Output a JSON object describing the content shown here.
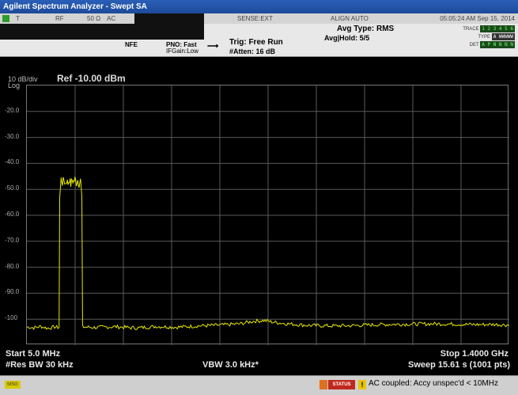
{
  "window": {
    "title": "Agilent Spectrum Analyzer - Swept SA"
  },
  "status_row": {
    "t": "T",
    "rf": "RF",
    "impedance": "50 Ω",
    "coupling": "AC",
    "sense": "SENSE:EXT",
    "align": "ALIGN AUTO",
    "timestamp": "05:05:24 AM Sep 15, 2014"
  },
  "settings": {
    "nfe": "NFE",
    "pno": "PNO: Fast",
    "ifgain": "IFGain:Low",
    "trig": "Trig: Free Run",
    "atten": "#Atten: 16 dB",
    "avg_type": "Avg Type: RMS",
    "avg_hold": "Avg|Hold: 5/5",
    "trace_label": "TRACE",
    "trace_value": "1 2 3 4 5 6",
    "type_label": "TYPE",
    "type_value": "A WWWWW",
    "det_label": "DET",
    "det_value": "A P N N N N"
  },
  "display": {
    "scale": "10 dB/div",
    "scale_type": "Log",
    "ref_level": "Ref -10.00 dBm"
  },
  "y_ticks": [
    "-20.0",
    "-30.0",
    "-40.0",
    "-50.0",
    "-60.0",
    "-70.0",
    "-80.0",
    "-90.0",
    "-100"
  ],
  "footer": {
    "start": "Start 5.0 MHz",
    "stop": "Stop 1.4000 GHz",
    "rbw": "#Res BW 30 kHz",
    "vbw": "VBW 3.0 kHz*",
    "sweep": "Sweep  15.61 s (1001 pts)"
  },
  "message_bar": {
    "msg_label": "MSG",
    "status_label": "STATUS",
    "warn_glyph": "!",
    "message": "AC coupled: Accy unspec'd < 10MHz"
  },
  "colors": {
    "trace": "#e8e800",
    "grid": "#5a5a5a",
    "background": "#000000"
  },
  "chart_data": {
    "type": "line",
    "ylim": [
      -110,
      -10
    ],
    "xlim_mhz": [
      5,
      1400
    ],
    "series": [
      {
        "points": [
          [
            5,
            -103.0
          ],
          [
            25,
            -103.3
          ],
          [
            45,
            -102.8
          ],
          [
            65,
            -103.5
          ],
          [
            85,
            -103.0
          ],
          [
            98,
            -103.2
          ],
          [
            100,
            -53.0
          ],
          [
            104,
            -46.0
          ],
          [
            108,
            -47.5
          ],
          [
            112,
            -46.2
          ],
          [
            116,
            -48.0
          ],
          [
            120,
            -46.5
          ],
          [
            124,
            -47.8
          ],
          [
            128,
            -46.1
          ],
          [
            132,
            -48.2
          ],
          [
            136,
            -46.4
          ],
          [
            140,
            -47.0
          ],
          [
            144,
            -46.0
          ],
          [
            148,
            -47.6
          ],
          [
            152,
            -46.3
          ],
          [
            156,
            -47.9
          ],
          [
            160,
            -46.5
          ],
          [
            164,
            -53.0
          ],
          [
            166,
            -103.0
          ],
          [
            200,
            -103.2
          ],
          [
            260,
            -102.9
          ],
          [
            320,
            -103.4
          ],
          [
            380,
            -102.8
          ],
          [
            440,
            -103.1
          ],
          [
            500,
            -102.6
          ],
          [
            560,
            -102.3
          ],
          [
            620,
            -101.8
          ],
          [
            660,
            -100.8
          ],
          [
            690,
            -100.5
          ],
          [
            720,
            -101.2
          ],
          [
            760,
            -101.8
          ],
          [
            820,
            -102.4
          ],
          [
            880,
            -102.6
          ],
          [
            940,
            -102.5
          ],
          [
            1000,
            -102.2
          ],
          [
            1060,
            -102.0
          ],
          [
            1120,
            -101.9
          ],
          [
            1180,
            -101.8
          ],
          [
            1240,
            -101.9
          ],
          [
            1300,
            -102.1
          ],
          [
            1360,
            -102.0
          ],
          [
            1400,
            -102.3
          ]
        ]
      }
    ]
  }
}
